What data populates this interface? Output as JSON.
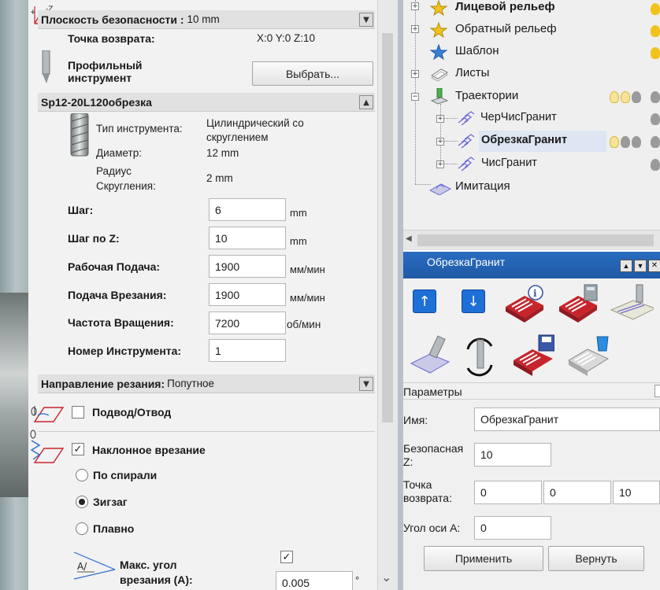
{
  "left_panel": {
    "safety_plane_label": "Плоскость безопасности :",
    "safety_plane_value": "10 mm",
    "return_point_label": "Точка возврата:",
    "return_point_value": "X:0 Y:0 Z:10",
    "profile_tool_label_1": "Профильный",
    "profile_tool_label_2": "инструмент",
    "select_button": "Выбрать...",
    "tool_name": "Sp12-20L120обрезка",
    "tool_type_label": "Тип инструмента:",
    "tool_type_value_1": "Цилиндрический со",
    "tool_type_value_2": "скруглением",
    "diameter_label": "Диаметр:",
    "diameter_value": "12 mm",
    "radius_label_1": "Радиус",
    "radius_label_2": "Скругления:",
    "radius_value": "2 mm",
    "fields": [
      {
        "label": "Шаг:",
        "value": "6",
        "unit": "mm"
      },
      {
        "label": "Шаг по Z:",
        "value": "10",
        "unit": "mm"
      },
      {
        "label": "Рабочая Подача:",
        "value": "1900",
        "unit": "мм/мин"
      },
      {
        "label": "Подача Врезания:",
        "value": "1900",
        "unit": "мм/мин"
      },
      {
        "label": "Частота Вращения:",
        "value": "7200",
        "unit": "об/мин"
      },
      {
        "label": "Номер Инструмента:",
        "value": "1",
        "unit": ""
      }
    ],
    "cut_direction_label": "Направление резания:",
    "cut_direction_value": "Попутное",
    "approach_label": "Подвод/Отвод",
    "approach_checked": false,
    "ramp_label": "Наклонное врезание",
    "ramp_checked": true,
    "ramp_options": [
      "По спирали",
      "Зигзаг",
      "Плавно"
    ],
    "ramp_selected": "Зигзаг",
    "max_angle_label_1": "Макс. угол",
    "max_angle_label_2": "врезания  (А):",
    "max_angle_checked": true,
    "max_angle_value": "0.005",
    "max_angle_unit": "°",
    "small_icon_text": "A/"
  },
  "tree": {
    "nodes": [
      {
        "label": "Лицевой рельеф",
        "bold": true
      },
      {
        "label": "Обратный рельеф",
        "bold": false
      },
      {
        "label": "Шаблон",
        "bold": false
      },
      {
        "label": "Листы",
        "bold": false
      },
      {
        "label": "Траектории",
        "bold": false
      },
      {
        "label": "ЧерЧисГранит",
        "bold": false
      },
      {
        "label": "ОбрезкаГранит",
        "bold": true
      },
      {
        "label": "ЧисГранит",
        "bold": false
      },
      {
        "label": "Имитация",
        "bold": false
      }
    ]
  },
  "toolpath_panel": {
    "title": "ОбрезкаГранит",
    "params_header": "Параметры",
    "name_label": "Имя:",
    "name_value": "ОбрезкаГранит",
    "safe_z_label_1": "Безопасная",
    "safe_z_label_2": "Z:",
    "safe_z_value": "10",
    "return_label_1": "Точка",
    "return_label_2": "возврата:",
    "return_x": "0",
    "return_y": "0",
    "return_z": "10",
    "a_axis_label": "Угол оси А:",
    "a_axis_value": "0",
    "apply_button": "Применить",
    "revert_button": "Вернуть"
  },
  "colors": {
    "title_blue": "#1f5aa6",
    "icon_red": "#c8242c",
    "icon_blue": "#2b6cd0",
    "highlight": "#dde6f2"
  }
}
